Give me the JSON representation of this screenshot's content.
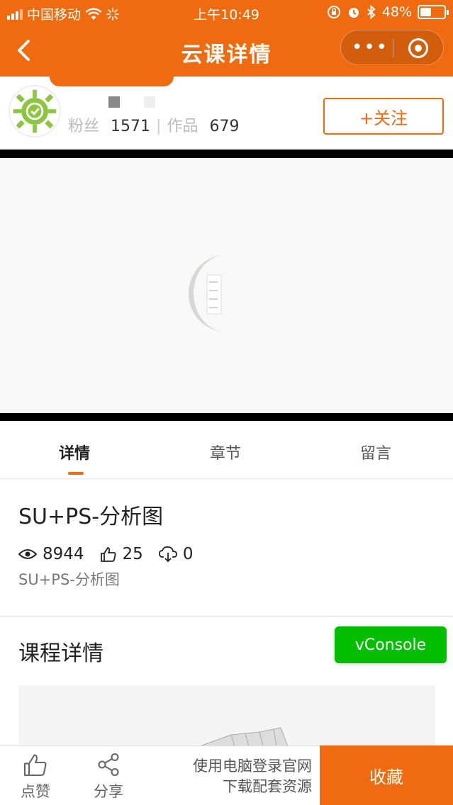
{
  "status_bar": {
    "carrier": "中国移动",
    "time": "上午10:49",
    "battery": "48%",
    "battery_level": 0.48,
    "icons": [
      "signal-icon",
      "wifi-icon",
      "loading-icon",
      "orientation-lock-icon",
      "alarm-icon",
      "bluetooth-icon",
      "battery-icon"
    ]
  },
  "nav": {
    "title": "云课详情",
    "back_icon": "chevron-left-icon",
    "more_label": "•••",
    "capsule_icon": "target-icon"
  },
  "author": {
    "fans_label": "粉丝",
    "fans_count": "1571",
    "works_label": "作品",
    "works_count": "679",
    "follow_label": "+关注"
  },
  "tabs": [
    {
      "label": "详情",
      "active": true
    },
    {
      "label": "章节",
      "active": false
    },
    {
      "label": "留言",
      "active": false
    }
  ],
  "course": {
    "title": "SU+PS-分析图",
    "views": "8944",
    "likes": "25",
    "downloads": "0",
    "subtitle": "SU+PS-分析图"
  },
  "detail": {
    "title": "课程详情"
  },
  "vconsole": {
    "label": "vConsole"
  },
  "bottom_bar": {
    "like_label": "点赞",
    "share_label": "分享",
    "note_line1": "使用电脑登录官网",
    "note_line2": "下载配套资源",
    "collect_label": "收藏"
  },
  "colors": {
    "brand": "#f06a0f",
    "vconsole": "#04be02"
  }
}
